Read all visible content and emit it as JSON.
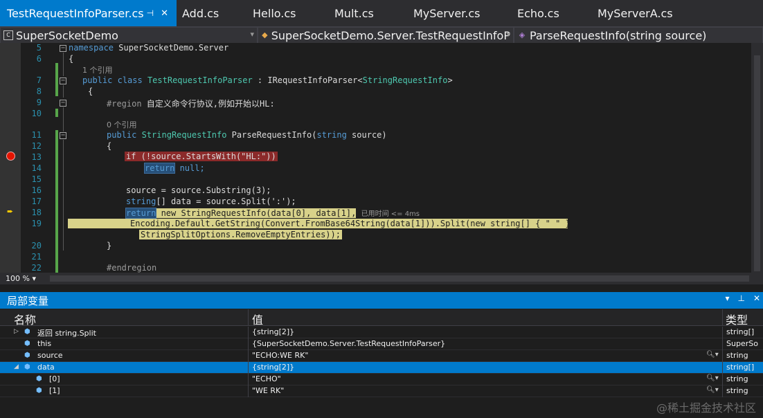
{
  "tabs": [
    {
      "label": "TestRequestInfoParser.cs",
      "active": true
    },
    {
      "label": "Add.cs"
    },
    {
      "label": "Hello.cs"
    },
    {
      "label": "Mult.cs"
    },
    {
      "label": "MyServer.cs"
    },
    {
      "label": "Echo.cs"
    },
    {
      "label": "MyServerA.cs"
    }
  ],
  "nav": {
    "project": "SuperSocketDemo",
    "type": "SuperSocketDemo.Server.TestRequestInfoP",
    "member": "ParseRequestInfo(string source)"
  },
  "code": {
    "line_numbers": [
      "5",
      "6",
      "7",
      "8",
      "9",
      "10",
      "11",
      "12",
      "13",
      "14",
      "15",
      "16",
      "17",
      "18",
      "19",
      "20",
      "21",
      "22"
    ],
    "refs1": "1 个引用",
    "refs0": "0 个引用",
    "namespace_kw": "namespace",
    "namespace_name": " SuperSocketDemo.Server",
    "brace_open": "{",
    "brace_close": "}",
    "public_kw": "public",
    "class_kw": "class",
    "class_name": "TestRequestInfoParser",
    "colon": " : ",
    "iface": "IRequestInfoParser",
    "lt": "<",
    "gen_type": "StringRequestInfo",
    "gt": ">",
    "region_kw": "#region",
    "region_text": " 自定义命令行协议,例如开始以HL:",
    "ret_type": "StringRequestInfo",
    "method_name": " ParseRequestInfo(",
    "string_kw": "string",
    "param": " source)",
    "line13": "if (!source.StartsWith(\"HL:\"))",
    "return_kw": "return",
    "null_text": " null;",
    "line16": "source = source.Substring(3);",
    "line17_rest": "[] data = source.Split(':');",
    "line18_rest": " new StringRequestInfo(data[0], data[1],",
    "elapsed": "已用时间 <= 4ms",
    "line19": "Encoding.Default.GetString(Convert.FromBase64String(data[1])).Split(new string[] { \" \" },",
    "line19b": "StringSplitOptions.RemoveEmptyEntries));",
    "endregion": "#endregion"
  },
  "zoom": "100 %",
  "locals": {
    "title": "局部变量",
    "col_name": "名称",
    "col_value": "值",
    "col_type": "类型",
    "rows": [
      {
        "name": "返回 string.Split",
        "value": "{string[2]}",
        "type": "string[]"
      },
      {
        "name": "this",
        "value": "{SuperSocketDemo.Server.TestRequestInfoParser}",
        "type": "SuperSo"
      },
      {
        "name": "source",
        "value": "\"ECHO:WE RK\"",
        "type": "string"
      },
      {
        "name": "data",
        "value": "{string[2]}",
        "type": "string[]"
      },
      {
        "name": "[0]",
        "value": "\"ECHO\"",
        "type": "string"
      },
      {
        "name": "[1]",
        "value": "\"WE RK\"",
        "type": "string"
      }
    ]
  },
  "watermark": "@稀土掘金技术社区",
  "colors": {
    "accent": "#007acc",
    "breakpoint": "#e51400",
    "current_line": "#d8d28a"
  }
}
